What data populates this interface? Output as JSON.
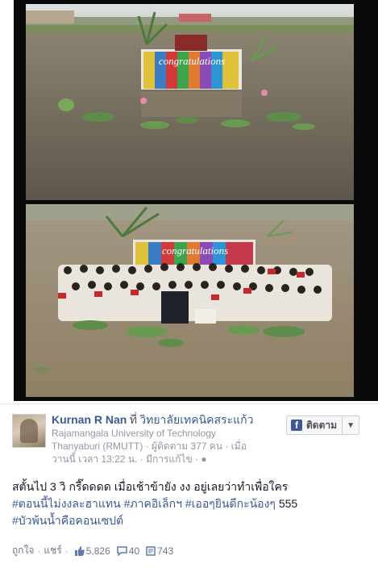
{
  "photos": {
    "top": {
      "banner_text": "congratulations"
    },
    "bottom": {
      "banner_text": "congratulations"
    }
  },
  "post": {
    "author": "Kurnan R Nan",
    "at_word": "ที่",
    "place": "วิทยาลัยเทคนิคสระแก้ว",
    "institution_line1": "Rajamangala University of Technology",
    "institution_line2": "Thanyaburi (RMUTT)",
    "followers": "· ผู้ติดตาม 377 คน · เมื่อ",
    "time": "วานนี้ เวลา 13:22 น.",
    "edited": "· มีการแก้ไข ·",
    "follow_label": "ติดตาม",
    "message_line1": "สตั้นไป 3 วิ กรี๊ดดดด เมื่อเช้าข้ายัง งง อยู่เลยว่าทำเพื่อใคร",
    "tags_line2a": "#ตอนนี้ไม่งงละฮาแทน",
    "tags_line2b": "#ภาคอิเล็กฯ",
    "tags_line2c": "#เออๆยินดีกะน้องๆ",
    "line2_tail": "555",
    "tags_line3": "#บัวพ้นน้ำคือคอนเซปต์",
    "like_label": "ถูกใจ",
    "share_label": "แชร์",
    "likes": "5,826",
    "comments": "40",
    "shares": "743"
  },
  "colors": {
    "link": "#3b5998",
    "water_top": "#6f6659",
    "water_bottom": "#9b8c74"
  }
}
